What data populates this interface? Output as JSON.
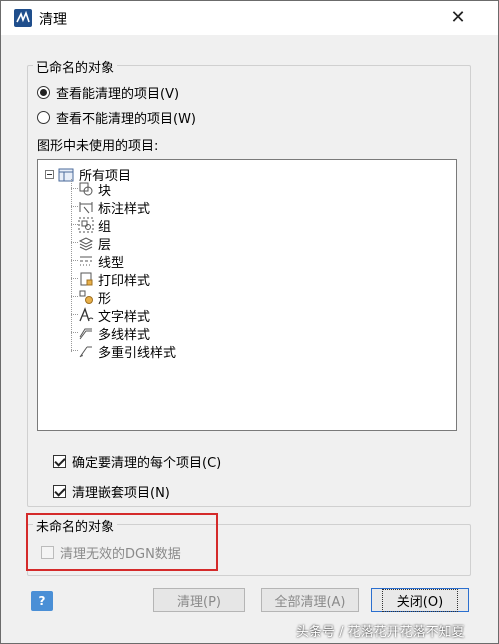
{
  "window": {
    "title": "清理"
  },
  "named_group": {
    "label": "已命名的对象",
    "radio_purgeable": "查看能清理的项目(V)",
    "radio_nonpurgeable": "查看不能清理的项目(W)",
    "tree_label": "图形中未使用的项目:",
    "tree": {
      "root": "所有项目",
      "items": [
        {
          "label": "块",
          "icon": "block-icon"
        },
        {
          "label": "标注样式",
          "icon": "dimension-style-icon"
        },
        {
          "label": "组",
          "icon": "group-icon"
        },
        {
          "label": "层",
          "icon": "layer-icon"
        },
        {
          "label": "线型",
          "icon": "linetype-icon"
        },
        {
          "label": "打印样式",
          "icon": "plot-style-icon"
        },
        {
          "label": "形",
          "icon": "shape-icon"
        },
        {
          "label": "文字样式",
          "icon": "text-style-icon"
        },
        {
          "label": "多线样式",
          "icon": "multiline-style-icon"
        },
        {
          "label": "多重引线样式",
          "icon": "multileader-style-icon"
        }
      ]
    },
    "confirm_each": "确定要清理的每个项目(C)",
    "purge_nested": "清理嵌套项目(N)"
  },
  "unnamed_group": {
    "label": "未命名的对象",
    "purge_dgn": "清理无效的DGN数据"
  },
  "buttons": {
    "help": "?",
    "purge": "清理(P)",
    "purge_all": "全部清理(A)",
    "close": "关闭(O)"
  },
  "watermark": "头条号 / 花落花开花落不知夏",
  "colors": {
    "highlight_box": "#d42a2a",
    "primary_button_border": "#2b6fcf"
  }
}
